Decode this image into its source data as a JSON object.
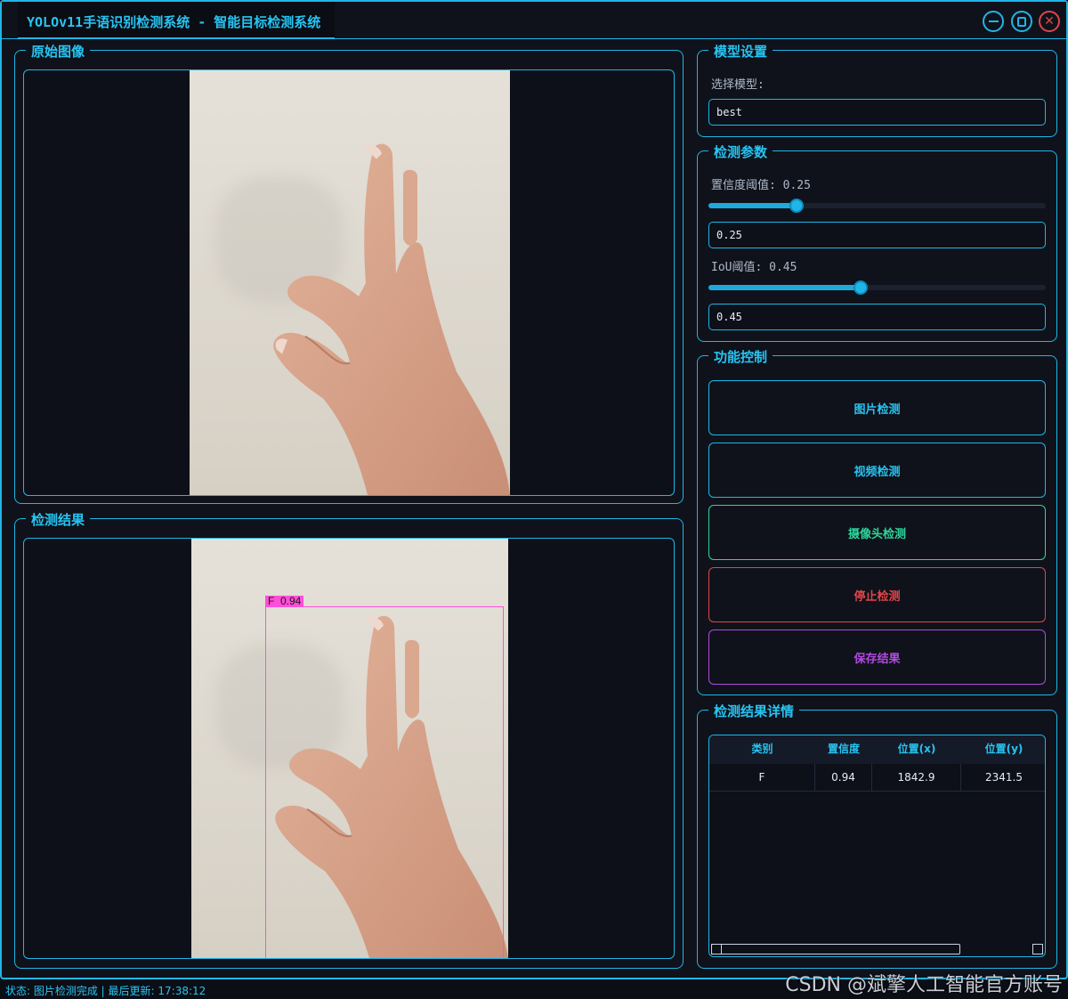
{
  "window": {
    "title": "YOLOv11手语识别检测系统 - 智能目标检测系统",
    "controls": [
      "minimize",
      "maximize",
      "close"
    ]
  },
  "panels": {
    "original": {
      "title": "原始图像"
    },
    "result": {
      "title": "检测结果",
      "box_label": "F  0.94"
    }
  },
  "model_settings": {
    "title": "模型设置",
    "select_label": "选择模型:",
    "selected_model": "best"
  },
  "detect_params": {
    "title": "检测参数",
    "confidence_label": "置信度阈值: 0.25",
    "confidence_value": "0.25",
    "confidence_fraction": 0.26,
    "iou_label": "IoU阈值: 0.45",
    "iou_value": "0.45",
    "iou_fraction": 0.45
  },
  "controls": {
    "title": "功能控制",
    "image_detect": "图片检测",
    "video_detect": "视频检测",
    "camera_detect": "摄像头检测",
    "stop_detect": "停止检测",
    "save_result": "保存结果"
  },
  "details": {
    "title": "检测结果详情",
    "columns": [
      "类别",
      "置信度",
      "位置(x)",
      "位置(y)"
    ],
    "rows": [
      [
        "F",
        "0.94",
        "1842.9",
        "2341.5"
      ]
    ]
  },
  "status": {
    "text": "状态: 图片检测完成 | 最后更新: 17:38:12"
  },
  "watermark": "CSDN @斌擎人工智能官方账号",
  "colors": {
    "accent": "#1fb6e6",
    "camera": "#2fd49b",
    "stop": "#e0454a",
    "save": "#b04be0",
    "box": "#ff4fd8"
  }
}
